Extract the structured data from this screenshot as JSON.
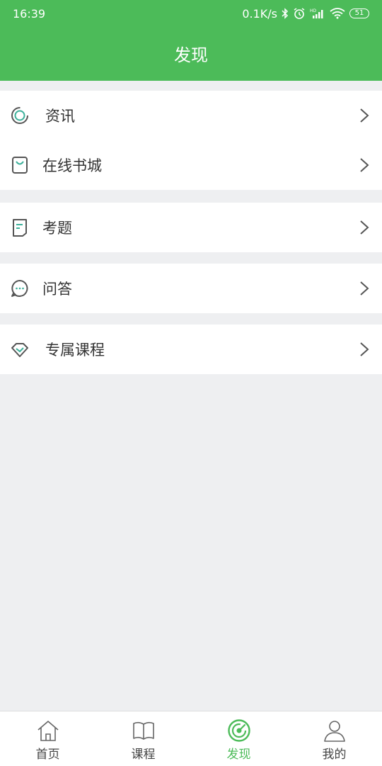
{
  "status_bar": {
    "time": "16:39",
    "network_speed": "0.1K/s",
    "battery": "51",
    "icons": [
      "bluetooth-icon",
      "alarm-icon",
      "hd-signal-icon",
      "wifi-icon",
      "battery-icon"
    ]
  },
  "header": {
    "title": "发现"
  },
  "menu": {
    "groups": [
      {
        "items": [
          {
            "label": "资讯",
            "icon": "news-icon"
          },
          {
            "label": "在线书城",
            "icon": "bookstore-bag-icon"
          }
        ]
      },
      {
        "items": [
          {
            "label": "考题",
            "icon": "exam-paper-icon"
          }
        ]
      },
      {
        "items": [
          {
            "label": "问答",
            "icon": "chat-bubble-icon"
          }
        ]
      },
      {
        "items": [
          {
            "label": "专属课程",
            "icon": "diamond-course-icon"
          }
        ]
      }
    ]
  },
  "tabbar": {
    "tabs": [
      {
        "label": "首页",
        "icon": "home-icon",
        "active": false
      },
      {
        "label": "课程",
        "icon": "open-book-icon",
        "active": false
      },
      {
        "label": "发现",
        "icon": "radar-discover-icon",
        "active": true
      },
      {
        "label": "我的",
        "icon": "user-icon",
        "active": false
      }
    ]
  },
  "colors": {
    "accent": "#4cbb59",
    "background": "#eeeff1",
    "icon_teal": "#3bb09a"
  }
}
